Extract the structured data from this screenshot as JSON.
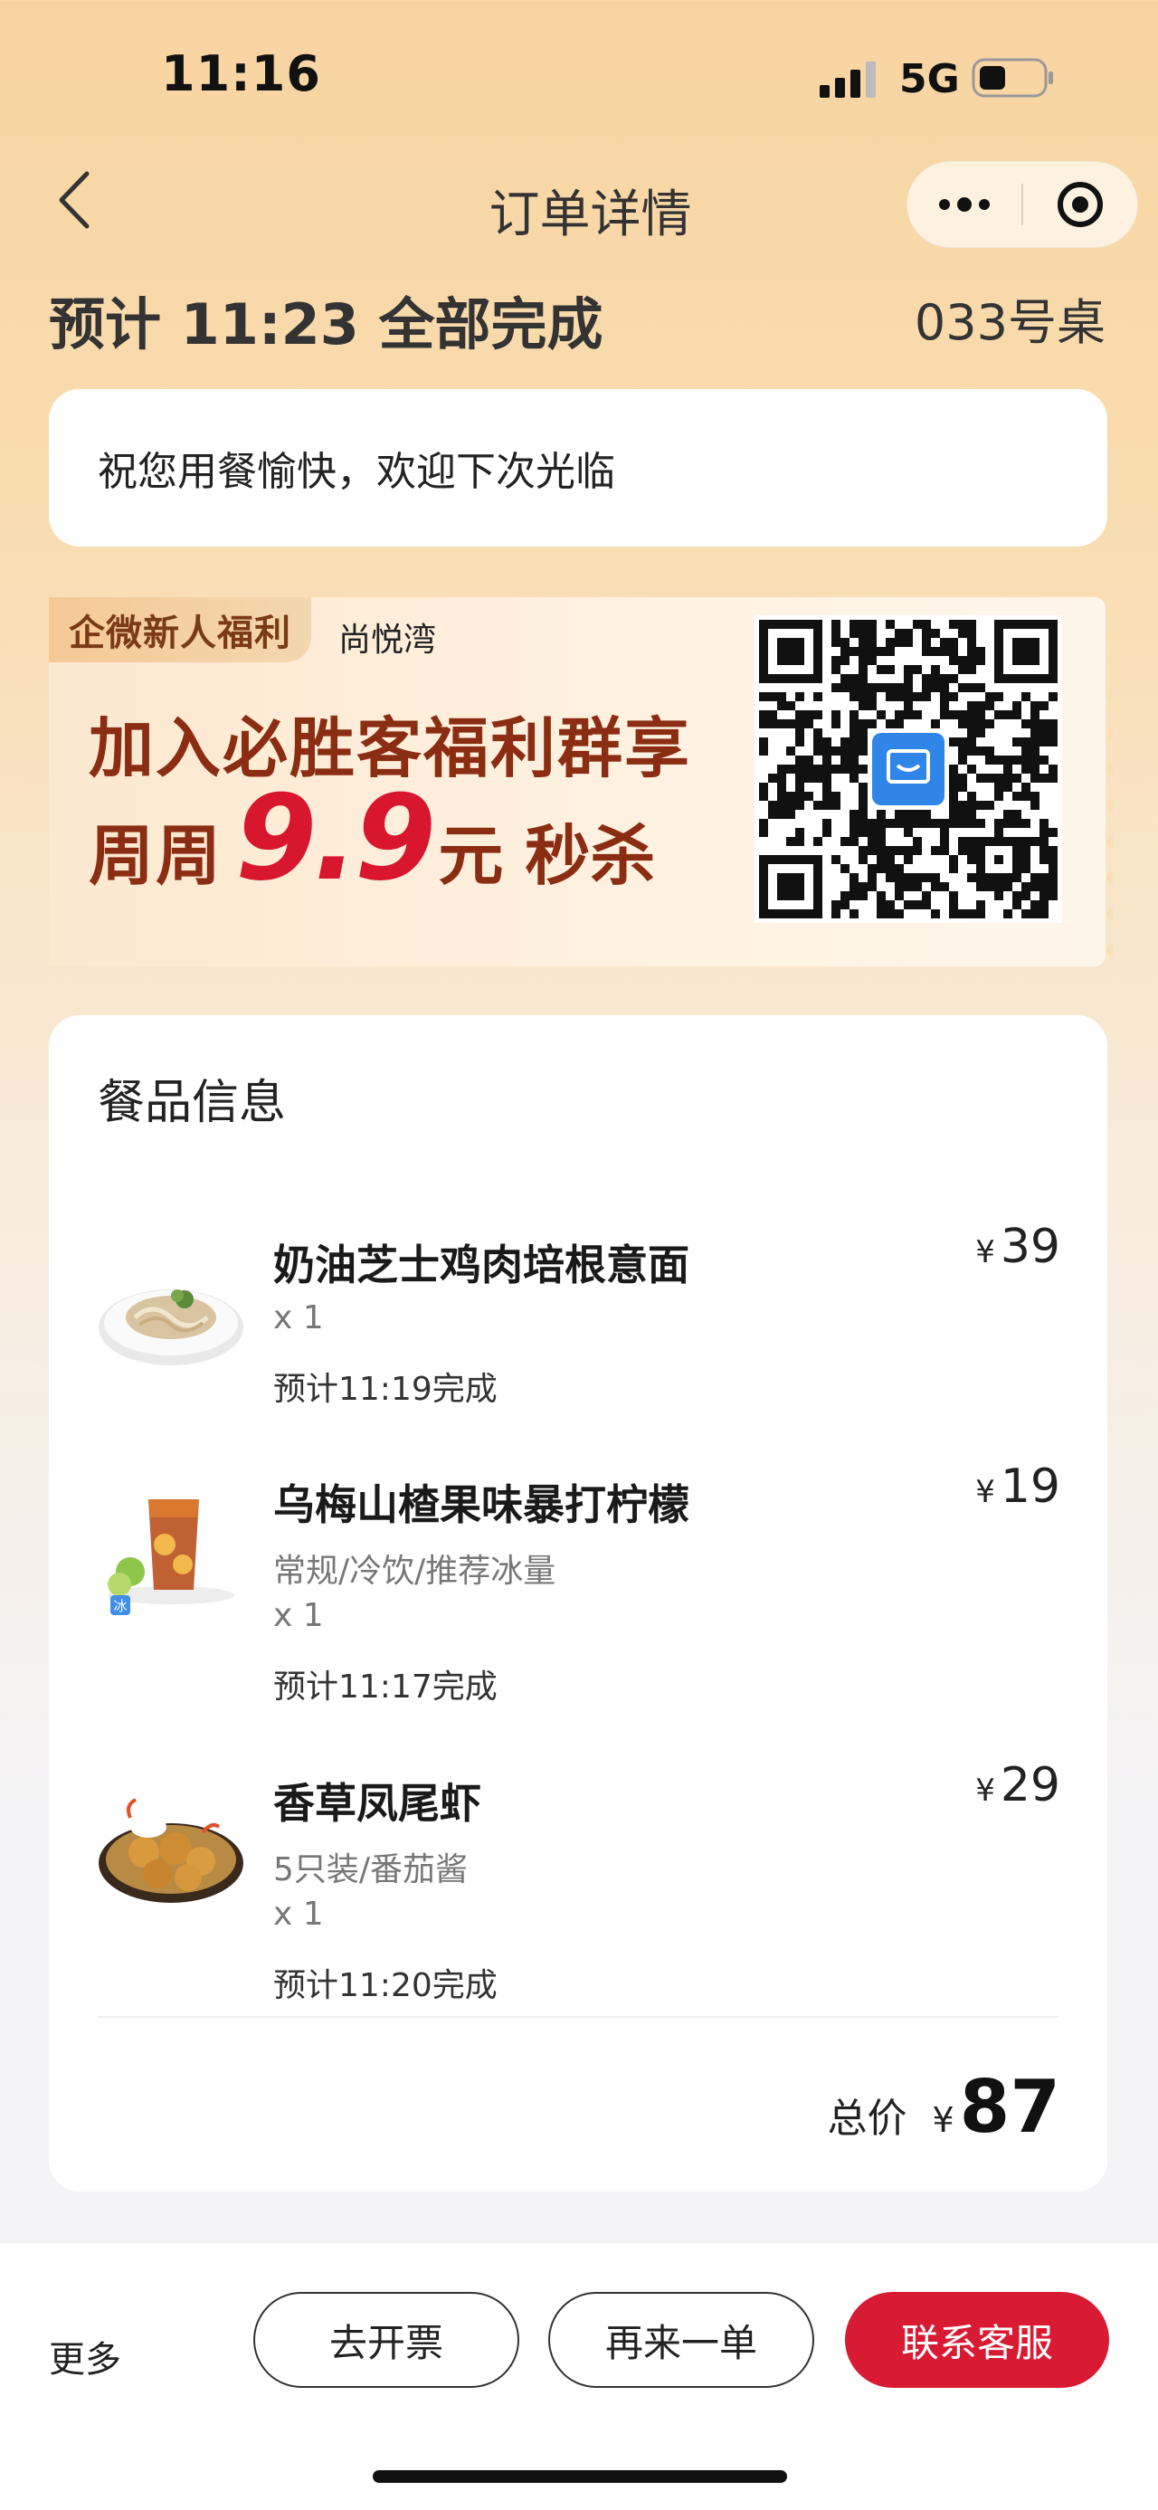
{
  "status_bar": {
    "time": "11:16",
    "network": "5G"
  },
  "nav": {
    "title": "订单详情"
  },
  "order": {
    "eta_text": "预计 11:23 全部完成",
    "table_no": "033号桌"
  },
  "message": "祝您用餐愉快，欢迎下次光临",
  "banner": {
    "tag": "企微新人福利",
    "store": "尚悦湾",
    "line1": "加入必胜客福利群享",
    "line2_prefix": "周周",
    "line2_price": "9.9",
    "line2_unit": "元",
    "line2_suffix": "秒杀"
  },
  "items_section": {
    "title": "餐品信息",
    "items": [
      {
        "name": "奶油芝士鸡肉培根意面",
        "currency": "¥",
        "price": "39",
        "spec": "",
        "qty": "x 1",
        "eta": "预计11:19完成",
        "thumb_icon": "pasta-icon"
      },
      {
        "name": "乌梅山楂果味暴打柠檬",
        "currency": "¥",
        "price": "19",
        "spec": "常规/冷饮/推荐冰量",
        "qty": "x 1",
        "eta": "预计11:17完成",
        "thumb_icon": "iced-drink-icon",
        "badge": "冰"
      },
      {
        "name": "香草凤尾虾",
        "currency": "¥",
        "price": "29",
        "spec": "5只装/番茄酱",
        "qty": "x 1",
        "eta": "预计11:20完成",
        "thumb_icon": "fried-shrimp-icon"
      }
    ],
    "total_label": "总价",
    "total_currency": "¥",
    "total_value": "87"
  },
  "bottom_bar": {
    "more": "更多",
    "invoice": "去开票",
    "reorder": "再来一单",
    "contact": "联系客服"
  },
  "colors": {
    "accent": "#d91a33",
    "banner_text": "#8a2d12",
    "price_red": "#d8162e"
  }
}
